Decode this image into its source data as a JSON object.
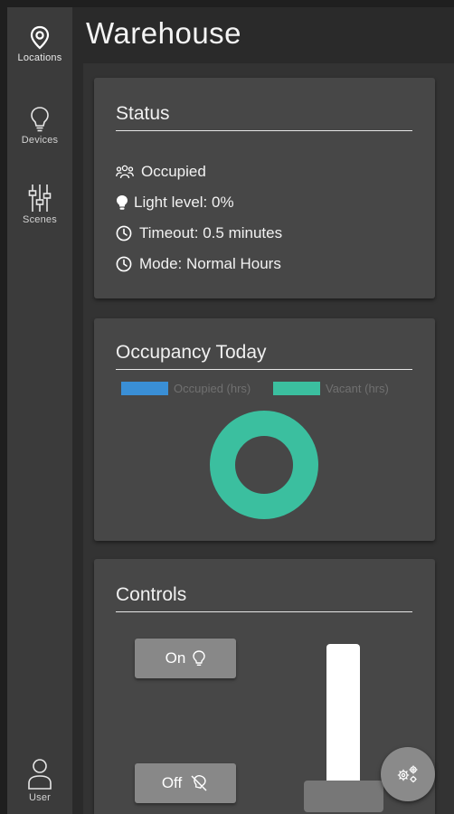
{
  "nav": {
    "items": [
      {
        "label": "Locations",
        "icon": "location-pin-icon",
        "active": true
      },
      {
        "label": "Devices",
        "icon": "lightbulb-icon",
        "active": false
      },
      {
        "label": "Scenes",
        "icon": "sliders-icon",
        "active": false
      }
    ],
    "user_label": "User"
  },
  "page": {
    "title": "Warehouse"
  },
  "status": {
    "title": "Status",
    "occupancy": "Occupied",
    "light_level": "Light level: 0%",
    "timeout": "Timeout: 0.5 minutes",
    "mode": "Mode: Normal Hours"
  },
  "occupancy_card": {
    "title": "Occupancy Today"
  },
  "chart_data": {
    "type": "pie",
    "title": "Occupancy Today",
    "categories": [
      "Occupied (hrs)",
      "Vacant (hrs)"
    ],
    "values": [
      0,
      1
    ],
    "colors": [
      "#3a8fd6",
      "#3bbf9f"
    ],
    "legend": "top",
    "donut": true
  },
  "controls": {
    "title": "Controls",
    "on_label": "On",
    "off_label": "Off",
    "slider_level": 0
  },
  "colors": {
    "occupied": "#3a8fd6",
    "vacant": "#3bbf9f"
  }
}
